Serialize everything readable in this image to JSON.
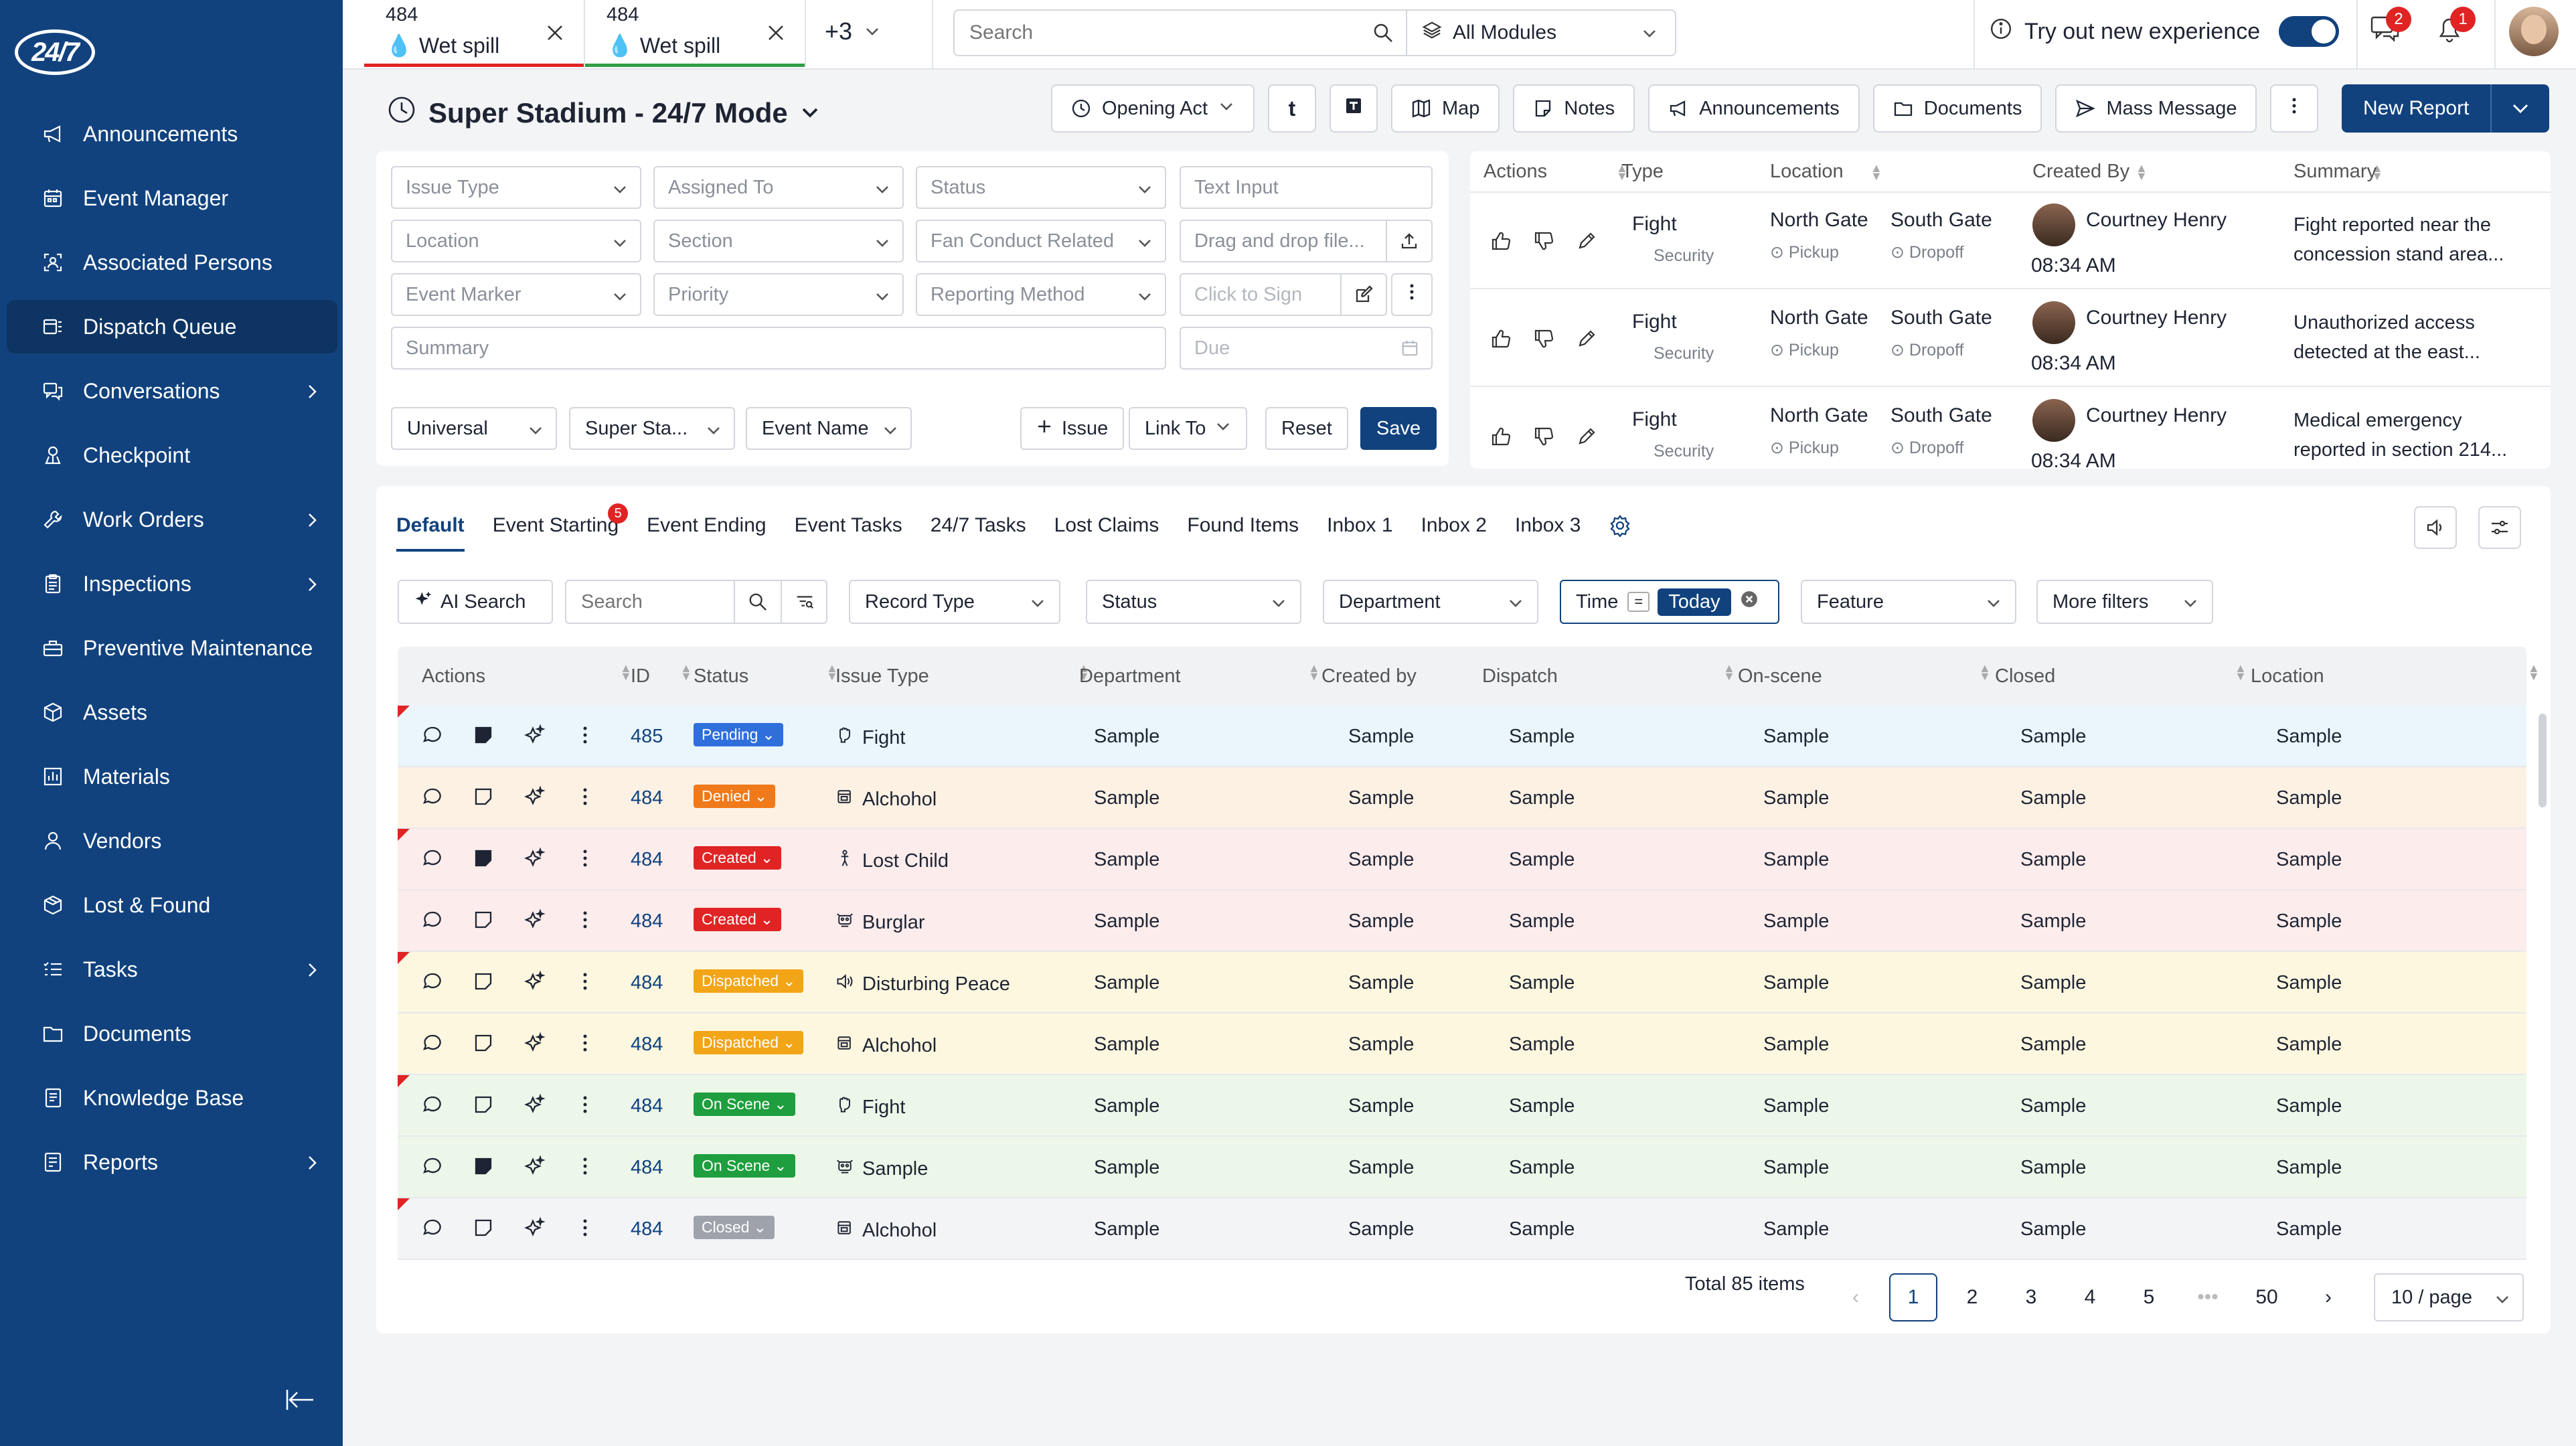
{
  "sidebar": {
    "logo": "24/7",
    "items": [
      {
        "label": "Announcements",
        "icon": "megaphone-icon",
        "chevron": false
      },
      {
        "label": "Event Manager",
        "icon": "calendar-icon",
        "chevron": false
      },
      {
        "label": "Associated Persons",
        "icon": "person-scan-icon",
        "chevron": false
      },
      {
        "label": "Dispatch Queue",
        "icon": "queue-icon",
        "chevron": false,
        "active": true
      },
      {
        "label": "Conversations",
        "icon": "chat-icon",
        "chevron": true
      },
      {
        "label": "Checkpoint",
        "icon": "checkpoint-icon",
        "chevron": false
      },
      {
        "label": "Work Orders",
        "icon": "wrench-icon",
        "chevron": true
      },
      {
        "label": "Inspections",
        "icon": "clipboard-icon",
        "chevron": true
      },
      {
        "label": "Preventive Maintenance",
        "icon": "toolbox-icon",
        "chevron": false
      },
      {
        "label": "Assets",
        "icon": "box-icon",
        "chevron": false
      },
      {
        "label": "Materials",
        "icon": "chart-icon",
        "chevron": false
      },
      {
        "label": "Vendors",
        "icon": "person-icon",
        "chevron": false
      },
      {
        "label": "Lost & Found",
        "icon": "package-icon",
        "chevron": false
      },
      {
        "label": "Tasks",
        "icon": "list-icon",
        "chevron": true
      },
      {
        "label": "Documents",
        "icon": "folder-icon",
        "chevron": false
      },
      {
        "label": "Knowledge Base",
        "icon": "book-icon",
        "chevron": false
      },
      {
        "label": "Reports",
        "icon": "report-icon",
        "chevron": true
      }
    ]
  },
  "topbar": {
    "tabs": [
      {
        "num": "484",
        "label": "Wet spill",
        "line": "#e02424"
      },
      {
        "num": "484",
        "label": "Wet spill",
        "line": "#2f9e44"
      }
    ],
    "more_tabs": "+3",
    "search_placeholder": "Search",
    "modules": "All Modules",
    "tryout": "Try out new experience",
    "chat_badge": "2",
    "bell_badge": "1"
  },
  "page": {
    "title": "Super Stadium - 24/7 Mode",
    "buttons": {
      "opening_act": "Opening Act",
      "t": "t",
      "map": "Map",
      "notes": "Notes",
      "announcements": "Announcements",
      "documents": "Documents",
      "mass_message": "Mass Message",
      "new_report": "New Report"
    }
  },
  "form": {
    "issue_type": "Issue Type",
    "assigned_to": "Assigned To",
    "status": "Status",
    "text_input": "Text Input",
    "location": "Location",
    "section": "Section",
    "fan_conduct": "Fan Conduct Related",
    "drag_drop": "Drag and drop file...",
    "event_marker": "Event Marker",
    "priority": "Priority",
    "reporting_method": "Reporting Method",
    "click_to_sign": "Click to Sign",
    "summary": "Summary",
    "due": "Due",
    "universal": "Universal",
    "super_sta": "Super Sta...",
    "event_name": "Event Name",
    "issue_btn": "Issue",
    "link_to": "Link To",
    "reset": "Reset",
    "save": "Save"
  },
  "mini_table": {
    "headers": [
      "Actions",
      "Type",
      "Location",
      "Created By",
      "Summary"
    ],
    "rows": [
      {
        "type": "Fight",
        "type_sub": "Security",
        "loc1": "North Gate",
        "loc1_sub": "Pickup",
        "loc2": "South Gate",
        "loc2_sub": "Dropoff",
        "created_by": "Courtney Henry",
        "time": "08:34 AM",
        "summary1": "Fight reported near the",
        "summary2": "concession stand area..."
      },
      {
        "type": "Fight",
        "type_sub": "Security",
        "loc1": "North Gate",
        "loc1_sub": "Pickup",
        "loc2": "South Gate",
        "loc2_sub": "Dropoff",
        "created_by": "Courtney Henry",
        "time": "08:34 AM",
        "summary1": "Unauthorized access",
        "summary2": "detected at the east..."
      },
      {
        "type": "Fight",
        "type_sub": "Security",
        "loc1": "North Gate",
        "loc1_sub": "Pickup",
        "loc2": "South Gate",
        "loc2_sub": "Dropoff",
        "created_by": "Courtney Henry",
        "time": "08:34 AM",
        "summary1": "Medical emergency",
        "summary2": "reported in section 214..."
      }
    ]
  },
  "views": {
    "tabs": [
      "Default",
      "Event Starting",
      "Event Ending",
      "Event Tasks",
      "24/7 Tasks",
      "Lost Claims",
      "Found Items",
      "Inbox 1",
      "Inbox 2",
      "Inbox 3"
    ],
    "event_starting_badge": "5"
  },
  "filters": {
    "ai_search": "AI Search",
    "search": "Search",
    "record_type": "Record Type",
    "status": "Status",
    "department": "Department",
    "time": "Time",
    "eq": "=",
    "today": "Today",
    "feature": "Feature",
    "more_filters": "More filters"
  },
  "grid": {
    "headers": [
      "Actions",
      "ID",
      "Status",
      "Issue Type",
      "Department",
      "Created by",
      "Dispatch",
      "On-scene",
      "Closed",
      "Location"
    ],
    "rows": [
      {
        "id": "485",
        "status": "Pending",
        "status_color": "#2f6fdb",
        "bg": "#eaf6fb",
        "type": "Fight",
        "type_icon": "fist-icon",
        "flag": true,
        "note_filled": true,
        "dept": "Sample",
        "created": "Sample",
        "dispatch": "Sample",
        "onscene": "Sample",
        "closed": "Sample",
        "location": "Sample"
      },
      {
        "id": "484",
        "status": "Denied",
        "status_color": "#f07a1a",
        "bg": "#fdf1e4",
        "type": "Alchohol",
        "type_icon": "bottle-icon",
        "flag": false,
        "note_filled": false,
        "dept": "Sample",
        "created": "Sample",
        "dispatch": "Sample",
        "onscene": "Sample",
        "closed": "Sample",
        "location": "Sample"
      },
      {
        "id": "484",
        "status": "Created",
        "status_color": "#e02424",
        "bg": "#fdecec",
        "type": "Lost Child",
        "type_icon": "child-icon",
        "flag": true,
        "note_filled": true,
        "dept": "Sample",
        "created": "Sample",
        "dispatch": "Sample",
        "onscene": "Sample",
        "closed": "Sample",
        "location": "Sample"
      },
      {
        "id": "484",
        "status": "Created",
        "status_color": "#e02424",
        "bg": "#fdecec",
        "type": "Burglar",
        "type_icon": "burglar-icon",
        "flag": false,
        "note_filled": false,
        "dept": "Sample",
        "created": "Sample",
        "dispatch": "Sample",
        "onscene": "Sample",
        "closed": "Sample",
        "location": "Sample"
      },
      {
        "id": "484",
        "status": "Dispatched",
        "status_color": "#f2a516",
        "bg": "#fdf7df",
        "type": "Disturbing Peace",
        "type_icon": "speaker-icon",
        "flag": true,
        "note_filled": false,
        "dept": "Sample",
        "created": "Sample",
        "dispatch": "Sample",
        "onscene": "Sample",
        "closed": "Sample",
        "location": "Sample"
      },
      {
        "id": "484",
        "status": "Dispatched",
        "status_color": "#f2a516",
        "bg": "#fdf7df",
        "type": "Alchohol",
        "type_icon": "bottle-icon",
        "flag": false,
        "note_filled": false,
        "dept": "Sample",
        "created": "Sample",
        "dispatch": "Sample",
        "onscene": "Sample",
        "closed": "Sample",
        "location": "Sample"
      },
      {
        "id": "484",
        "status": "On Scene",
        "status_color": "#1e9e3e",
        "bg": "#ecf7e9",
        "type": "Fight",
        "type_icon": "fist-icon",
        "flag": true,
        "note_filled": false,
        "dept": "Sample",
        "created": "Sample",
        "dispatch": "Sample",
        "onscene": "Sample",
        "closed": "Sample",
        "location": "Sample"
      },
      {
        "id": "484",
        "status": "On Scene",
        "status_color": "#1e9e3e",
        "bg": "#ecf7e9",
        "type": "Sample",
        "type_icon": "burglar-icon",
        "flag": false,
        "note_filled": true,
        "dept": "Sample",
        "created": "Sample",
        "dispatch": "Sample",
        "onscene": "Sample",
        "closed": "Sample",
        "location": "Sample"
      },
      {
        "id": "484",
        "status": "Closed",
        "status_color": "#9ea3ab",
        "bg": "#f3f4f6",
        "type": "Alchohol",
        "type_icon": "bottle-icon",
        "flag": true,
        "note_filled": false,
        "dept": "Sample",
        "created": "Sample",
        "dispatch": "Sample",
        "onscene": "Sample",
        "closed": "Sample",
        "location": "Sample"
      }
    ]
  },
  "pagination": {
    "total": "Total 85 items",
    "pages": [
      "1",
      "2",
      "3",
      "4",
      "5",
      "•••",
      "50"
    ],
    "per_page": "10 / page"
  }
}
